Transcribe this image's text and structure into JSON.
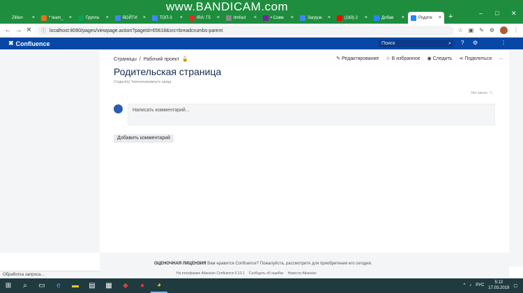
{
  "browser": {
    "tabs": [
      {
        "label": "Zillion",
        "color": "#1e8e3e"
      },
      {
        "label": "* team_",
        "color": "#e8711a"
      },
      {
        "label": "Группа",
        "color": "#0f9d58"
      },
      {
        "label": "ВОЙТИ",
        "color": "#4285f4"
      },
      {
        "label": "ТОП-3",
        "color": "#4285f4"
      },
      {
        "label": "IRA: Г5",
        "color": "#d93025"
      },
      {
        "label": "itmfact",
        "color": "#888888"
      },
      {
        "label": "• Совм",
        "color": "#7b1fa2"
      },
      {
        "label": "Загрузк",
        "color": "#4285f4"
      },
      {
        "label": "(163) 2",
        "color": "#ff0000"
      },
      {
        "label": "Добав",
        "color": "#2684ff"
      },
      {
        "label": "Родите",
        "color": "#2684ff"
      }
    ],
    "active_tab_index": 11,
    "new_tab_label": "+",
    "window_controls": {
      "minimize": "–",
      "maximize": "□",
      "close": "✕"
    },
    "watermark": "www.BANDICAM.com",
    "url": "localhost:8090/pages/viewpage.action?pageId=65618&src=breadcrumbs-parent",
    "nav": {
      "back": "←",
      "forward": "→",
      "reload": "✕"
    },
    "toolbar_icons": [
      "star-icon",
      "extension-icon",
      "extension-icon",
      "settings-icon",
      "profile-avatar",
      "more-icon"
    ]
  },
  "confluence": {
    "logo_text": "Confluence",
    "search_placeholder": "Поиск",
    "header_icons": [
      "help-icon",
      "gear-icon",
      "menu-icon"
    ],
    "breadcrumb": [
      "Страницы",
      "Рабочий проект"
    ],
    "actions": {
      "edit": "Редактирование",
      "favorite": "В избранное",
      "watch": "Следить",
      "share": "Поделиться",
      "more": "…"
    },
    "page_title": "Родительская страница",
    "created_meta": "Создал(а) Текеничевкамнуть назад",
    "no_labels": "Нет меток",
    "comment_placeholder": "Написать комментарий...",
    "add_comment_label": "Добавить комментарий",
    "footer": {
      "license_title": "ОЦЕНОЧНАЯ ЛИЦЕНЗИЯ",
      "license_text": "Вам нравится Confluence? Пожалуйста, рассмотрите для приобретения его сегодня.",
      "links": [
        "На платформе Atlassian Confluence 6.15.1",
        "Сообщить об ошибке",
        "Новости Atlassian"
      ]
    }
  },
  "status_bar": "Обработка запроса...",
  "taskbar": {
    "items": [
      "windows-icon",
      "search-icon",
      "task-view-icon",
      "edge-icon",
      "explorer-icon",
      "store-icon",
      "calculator-icon",
      "media-icon",
      "record-icon",
      "chrome-icon"
    ],
    "lang": "РУС",
    "time": "5:12",
    "date": "17.03.2019"
  }
}
